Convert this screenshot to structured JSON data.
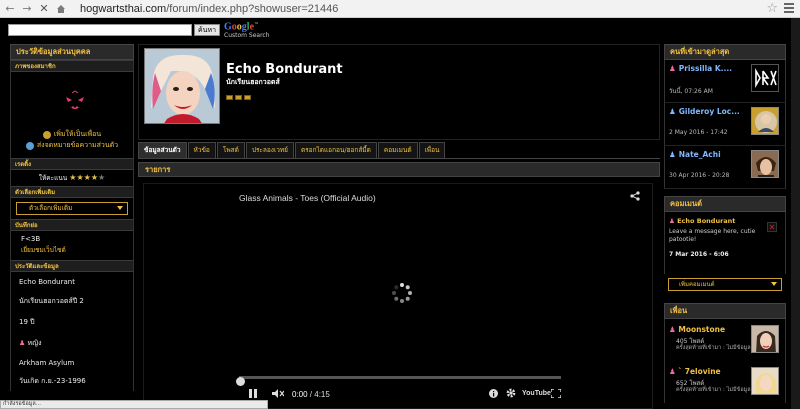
{
  "browser": {
    "url_host": "hogwartsthai.com",
    "url_path": "/forum/index.php?showuser=21446"
  },
  "search": {
    "button_label": "ค้นหา",
    "brand_google": "Google",
    "brand_sub": "Custom Search"
  },
  "left": {
    "title": "ประวัติข้อมูลส่วนบุคคล",
    "avatar_label": "ภาพของสมาชิก",
    "add_friend": "เพิ่มให้เป็นเพื่อน",
    "send_pm": "ส่งจดหมายข้อความส่วนตัว",
    "rating_label": "เรตติ้ง",
    "rating_text": "ให้คะแนน",
    "rating_value": 4,
    "rating_max": 5,
    "options_label": "ตัวเลือกเพิ่มเติม",
    "options_select": "ตัวเลือกเพิ่มเติม",
    "signature_label": "บันทึกย่อ",
    "signature_line1": "F<3B",
    "signature_line2": "เยี่ยมชมเว็บไซต์",
    "info_label": "ประวัติและข้อมูล",
    "info_name": "Echo Bondurant",
    "info_year": "นักเรียนฮอกวอตส์ปี 2",
    "info_age": "19 ปี",
    "info_gender": "หญิง",
    "info_house": "Arkham Asylum",
    "info_birthday": "วันเกิด ก.ย.-23-1996"
  },
  "profile": {
    "name": "Echo Bondurant",
    "rank": "นักเรียนฮอกวอตส์"
  },
  "tabs": [
    {
      "label": "ข้อมูลส่วนตัว",
      "active": true
    },
    {
      "label": "หัวข้อ",
      "active": false
    },
    {
      "label": "โพสต์",
      "active": false
    },
    {
      "label": "ประลองเวทย์",
      "active": false
    },
    {
      "label": "ตรอกไดแอกอน/ฮอกส์มี้ด",
      "active": false
    },
    {
      "label": "คอมเมนต์",
      "active": false
    },
    {
      "label": "เพื่อน",
      "active": false
    }
  ],
  "section": {
    "title": "รายการ"
  },
  "video": {
    "title": "Glass Animals - Toes (Official Audio)",
    "current_time": "0:00",
    "duration": "4:15",
    "progress": 0,
    "brand": "YouTube"
  },
  "right": {
    "visitors_title": "คนที่เข้ามาดูล่าสุด",
    "visitors": [
      {
        "name": "Prissilla K....",
        "date": "วันนี้, 07:26 AM",
        "sex": "female"
      },
      {
        "name": "Gilderoy Loc...",
        "date": "2 May 2016 - 17:42",
        "sex": "male"
      },
      {
        "name": "Nate_Achi",
        "date": "30 Apr 2016 - 20:28",
        "sex": "male"
      }
    ],
    "comments_title": "คอมเมนต์",
    "comment": {
      "author": "Echo Bondurant",
      "text": "Leave a message here, cutie patootie!",
      "date": "7 Mar 2016 - 6:06"
    },
    "add_comment": "เพิ่มคอมเมนต์",
    "friends_title": "เพื่อน",
    "friends": [
      {
        "name": "Moonstone",
        "posts": "405 โพสต์",
        "status": "ครั้งสุดท้ายที่เข้ามา : ไม่มีข้อมูล"
      },
      {
        "name": "` 7elovine",
        "posts": "652 โพสต์",
        "status": "ครั้งสุดท้ายที่เข้ามา : ไม่มีข้อมูล"
      }
    ]
  },
  "status": {
    "text": "กำลังรอข้อมูล..."
  },
  "colors": {
    "accent": "#f0c040",
    "link_blue": "#7fb8ff",
    "female_pink": "#f06aa0"
  }
}
